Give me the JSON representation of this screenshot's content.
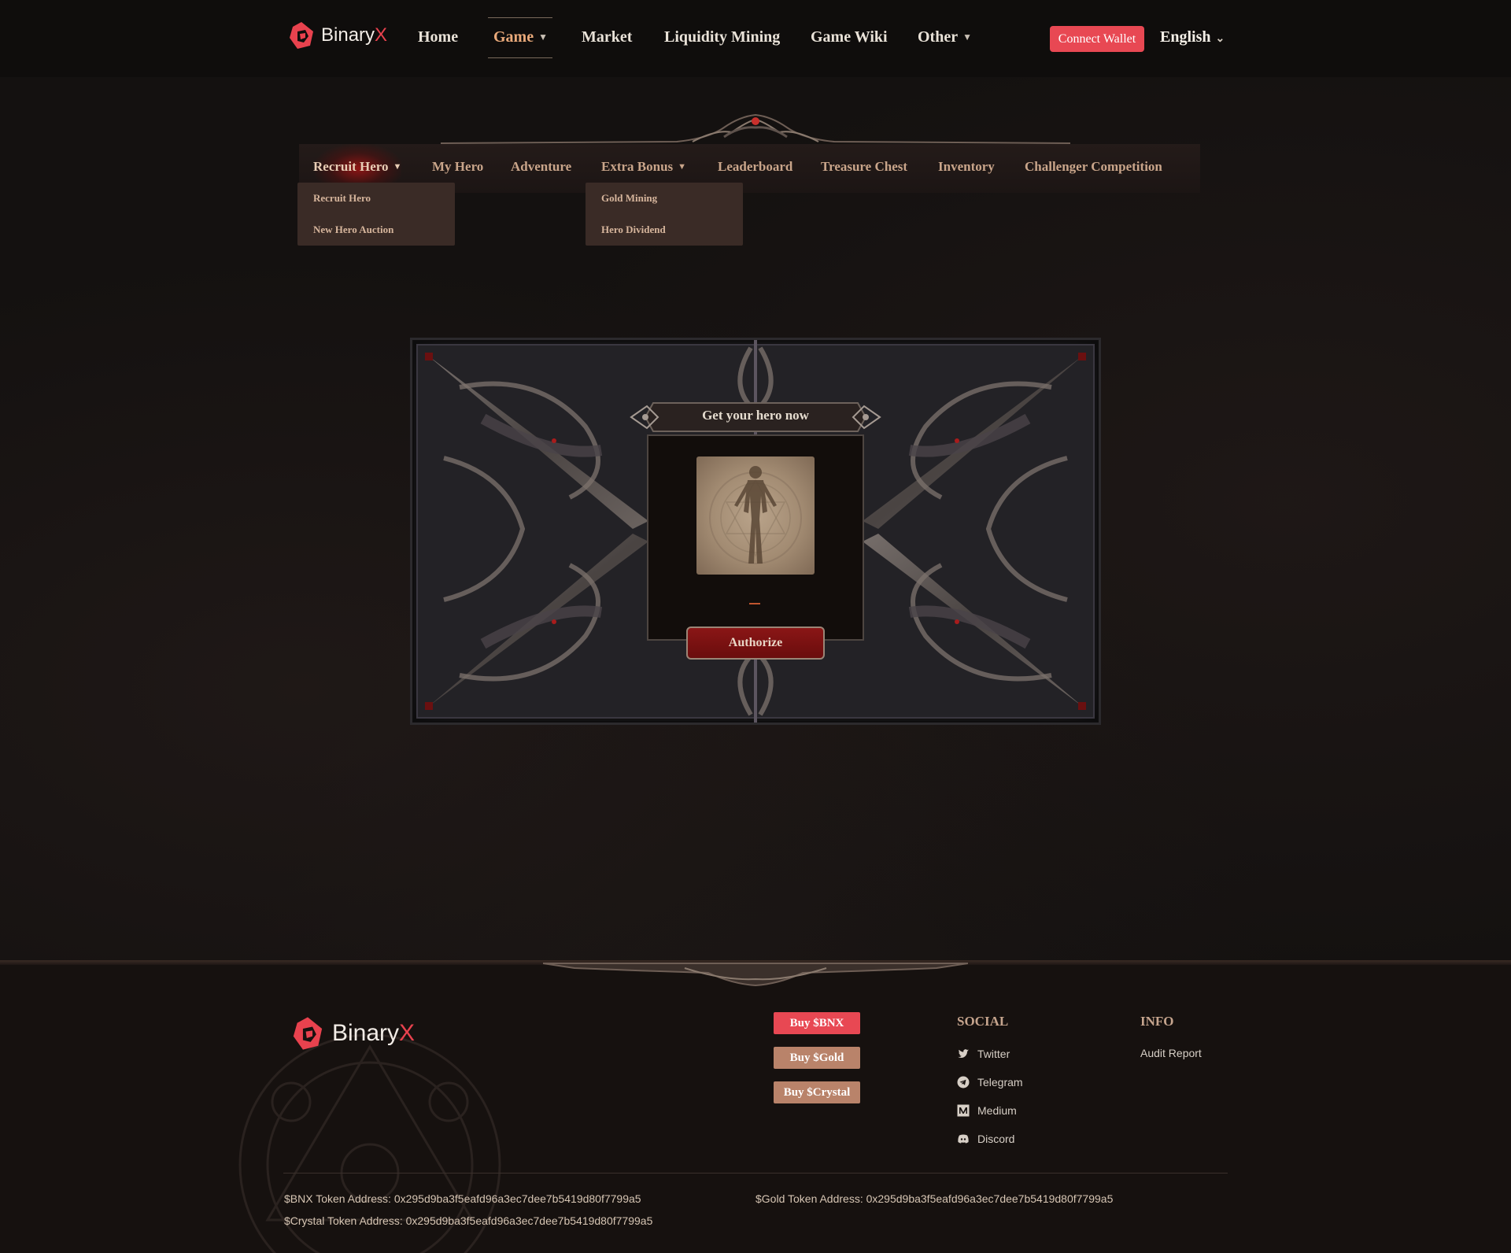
{
  "header": {
    "logo_text": "Binary",
    "logo_x": "X",
    "nav": [
      {
        "label": "Home"
      },
      {
        "label": "Game",
        "active": true,
        "has_caret": true
      },
      {
        "label": "Market"
      },
      {
        "label": "Liquidity Mining"
      },
      {
        "label": "Game Wiki"
      },
      {
        "label": "Other",
        "has_caret": true
      }
    ],
    "connect_wallet": "Connect Wallet",
    "language": "English"
  },
  "subnav": {
    "items": [
      {
        "label": "Recruit Hero",
        "active": true,
        "has_caret": true
      },
      {
        "label": "My Hero"
      },
      {
        "label": "Adventure"
      },
      {
        "label": "Extra Bonus",
        "has_caret": true
      },
      {
        "label": "Leaderboard"
      },
      {
        "label": "Treasure Chest"
      },
      {
        "label": "Inventory"
      },
      {
        "label": "Challenger Competition"
      }
    ],
    "recruit_dropdown": [
      "Recruit Hero",
      "New Hero Auction"
    ],
    "bonus_dropdown": [
      "Gold Mining",
      "Hero Dividend"
    ]
  },
  "card": {
    "title": "Get your hero now",
    "value": "—",
    "authorize": "Authorize"
  },
  "footer": {
    "logo_text": "Binary",
    "logo_x": "X",
    "buy_bnx": "Buy $BNX",
    "buy_gold": "Buy $Gold",
    "buy_crystal": "Buy $Crystal",
    "social_title": "SOCIAL",
    "social": [
      "Twitter",
      "Telegram",
      "Medium",
      "Discord"
    ],
    "info_title": "INFO",
    "info": [
      "Audit Report"
    ],
    "bnx_address": "$BNX Token Address: 0x295d9ba3f5eafd96a3ec7dee7b5419d80f7799a5",
    "gold_address": "$Gold Token Address: 0x295d9ba3f5eafd96a3ec7dee7b5419d80f7799a5",
    "crystal_address": "$Crystal Token Address: 0x295d9ba3f5eafd96a3ec7dee7b5419d80f7799a5"
  },
  "colors": {
    "accent_red": "#e84853",
    "active_nav": "#e9a97a",
    "gold_btn": "#b9836a"
  }
}
